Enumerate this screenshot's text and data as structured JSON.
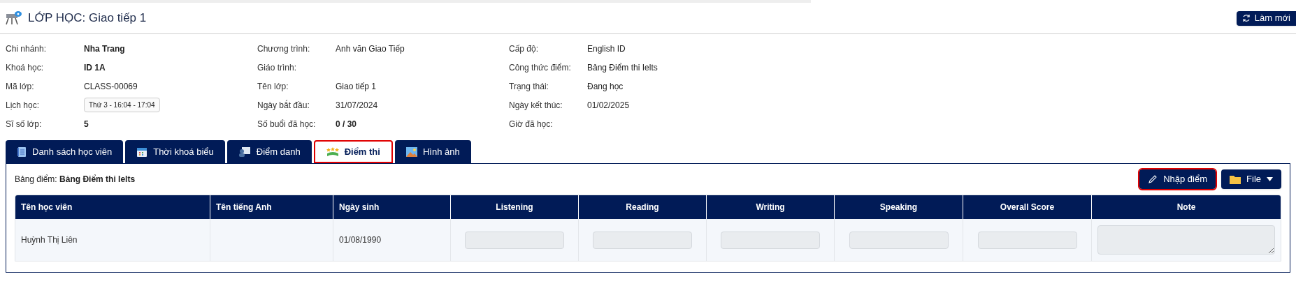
{
  "header": {
    "title": "LỚP HỌC: Giao tiếp 1",
    "refresh_button": "Làm mới"
  },
  "info_columns": [
    {
      "fields": [
        {
          "label": "Chi nhánh:",
          "value": "Nha Trang",
          "kind": "bold"
        },
        {
          "label": "Khoá học:",
          "value": "ID 1A",
          "kind": "bold"
        },
        {
          "label": "Mã lớp:",
          "value": "CLASS-00069",
          "kind": "plain"
        },
        {
          "label": "Lịch học:",
          "value": "Thứ 3 - 16:04 - 17:04",
          "kind": "chip"
        },
        {
          "label": "Sĩ số lớp:",
          "value": "5",
          "kind": "bold"
        }
      ]
    },
    {
      "fields": [
        {
          "label": "Chương trình:",
          "value": "Anh văn Giao Tiếp",
          "kind": "plain"
        },
        {
          "label": "Giáo trình:"
        },
        {
          "label": "Tên lớp:",
          "value": "Giao tiếp 1",
          "kind": "plain"
        },
        {
          "label": "Ngày bắt đầu:",
          "value": "31/07/2024",
          "kind": "plain"
        },
        {
          "label": "Số buổi đã học:",
          "value": "0 / 30",
          "kind": "bold"
        }
      ]
    },
    {
      "fields": [
        {
          "label": "Cấp độ:",
          "value": "English ID",
          "kind": "plain"
        },
        {
          "label": "Công thức điểm:",
          "value": "Bảng Điểm thi Ielts",
          "kind": "plain"
        },
        {
          "label": "Trạng thái:",
          "value": "Đang học",
          "kind": "plain"
        },
        {
          "label": "Ngày kết thúc:",
          "value": "01/02/2025",
          "kind": "plain"
        },
        {
          "label": "Giờ đã học:"
        }
      ]
    }
  ],
  "tabs": [
    {
      "label": "Danh sách học viên",
      "kind": "list",
      "selected": false
    },
    {
      "label": "Thời khoá biểu",
      "kind": "calendar",
      "selected": false
    },
    {
      "label": "Điểm danh",
      "kind": "attendance",
      "selected": false
    },
    {
      "label": "Điểm thi",
      "kind": "stars",
      "selected": true
    },
    {
      "label": "Hình ảnh",
      "kind": "image",
      "selected": false
    }
  ],
  "score_panel": {
    "label": "Bảng điểm:",
    "value": "Bảng Điểm thi Ielts",
    "buttons": [
      {
        "label": "Nhập điểm",
        "kind": "edit",
        "highlighted": true
      },
      {
        "label": "File",
        "kind": "file",
        "highlighted": false
      }
    ]
  },
  "table": {
    "columns": [
      {
        "label": "Tên học viên",
        "kind": "info"
      },
      {
        "label": "Tên tiếng Anh",
        "kind": "info"
      },
      {
        "label": "Ngày sinh",
        "kind": "info"
      },
      {
        "label": "Listening",
        "kind": "score"
      },
      {
        "label": "Reading",
        "kind": "score"
      },
      {
        "label": "Writing",
        "kind": "score"
      },
      {
        "label": "Speaking",
        "kind": "score"
      },
      {
        "label": "Overall Score",
        "kind": "score"
      },
      {
        "label": "Note",
        "kind": "score"
      }
    ],
    "rows": [
      {
        "cells": [
          {
            "kind": "text",
            "text": "Huỳnh Thị Liên"
          },
          {
            "kind": "empty"
          },
          {
            "kind": "text",
            "text": "01/08/1990"
          },
          {
            "kind": "input",
            "disabled": true
          },
          {
            "kind": "input",
            "disabled": true
          },
          {
            "kind": "input",
            "disabled": true
          },
          {
            "kind": "input",
            "disabled": true
          },
          {
            "kind": "input",
            "disabled": true
          },
          {
            "kind": "textarea",
            "disabled": true
          }
        ]
      }
    ]
  }
}
